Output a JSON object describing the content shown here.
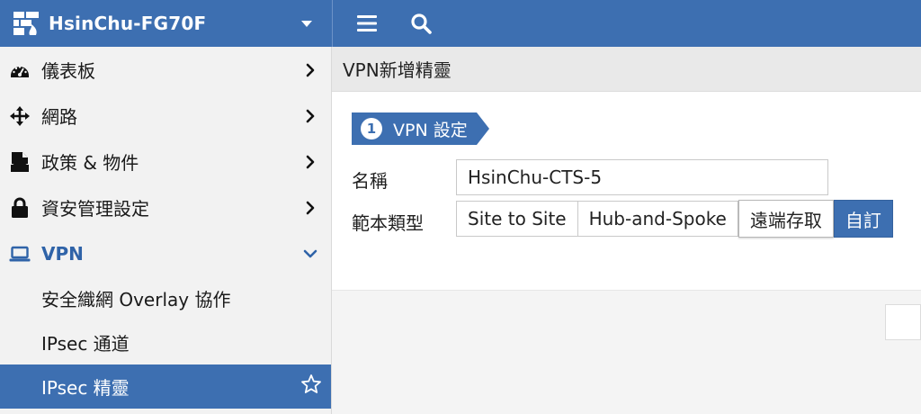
{
  "header": {
    "device_name": "HsinChu-FG70F",
    "logo_icon": "fortigate-logo-icon",
    "menu_icon": "hamburger-icon",
    "search_icon": "search-icon",
    "accent_color": "#3d6fb1"
  },
  "sidebar": {
    "items": [
      {
        "label": "儀表板",
        "icon": "dashboard-icon"
      },
      {
        "label": "網路",
        "icon": "network-arrows-icon"
      },
      {
        "label": "政策 & 物件",
        "icon": "policy-document-icon"
      },
      {
        "label": "資安管理設定",
        "icon": "lock-icon"
      },
      {
        "label": "VPN",
        "icon": "laptop-icon"
      }
    ],
    "vpn_subitems": [
      {
        "label": "安全織網 Overlay 協作"
      },
      {
        "label": "IPsec 通道"
      },
      {
        "label": "IPsec 精靈",
        "icon": "star-icon"
      }
    ]
  },
  "main": {
    "page_title": "VPN新增精靈",
    "step": {
      "number": "1",
      "label": "VPN 設定"
    },
    "name_label": "名稱",
    "name_value": "HsinChu-CTS-5",
    "template_label": "範本類型",
    "template_options": [
      "Site to Site",
      "Hub-and-Spoke",
      "遠端存取",
      "自訂"
    ],
    "template_selected": "自訂"
  }
}
